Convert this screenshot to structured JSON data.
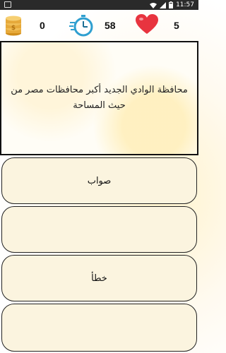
{
  "status_bar": {
    "time": "11:57"
  },
  "hud": {
    "coins": "0",
    "timer_seconds": "58",
    "lives": "5",
    "coin_icon": "coins-icon",
    "timer_icon": "stopwatch-icon",
    "lives_icon": "heart-icon"
  },
  "question": {
    "text": "محافظة الوادي الجديد أكبر محافظات مصر من حيث المساحة"
  },
  "answers": [
    {
      "label": "صواب"
    },
    {
      "label": ""
    },
    {
      "label": "خطأ"
    },
    {
      "label": ""
    }
  ],
  "colors": {
    "answer_bg": "#fbf4df",
    "heart": "#e8343f",
    "timer": "#2f9fd0",
    "coin": "#e6a93a"
  }
}
